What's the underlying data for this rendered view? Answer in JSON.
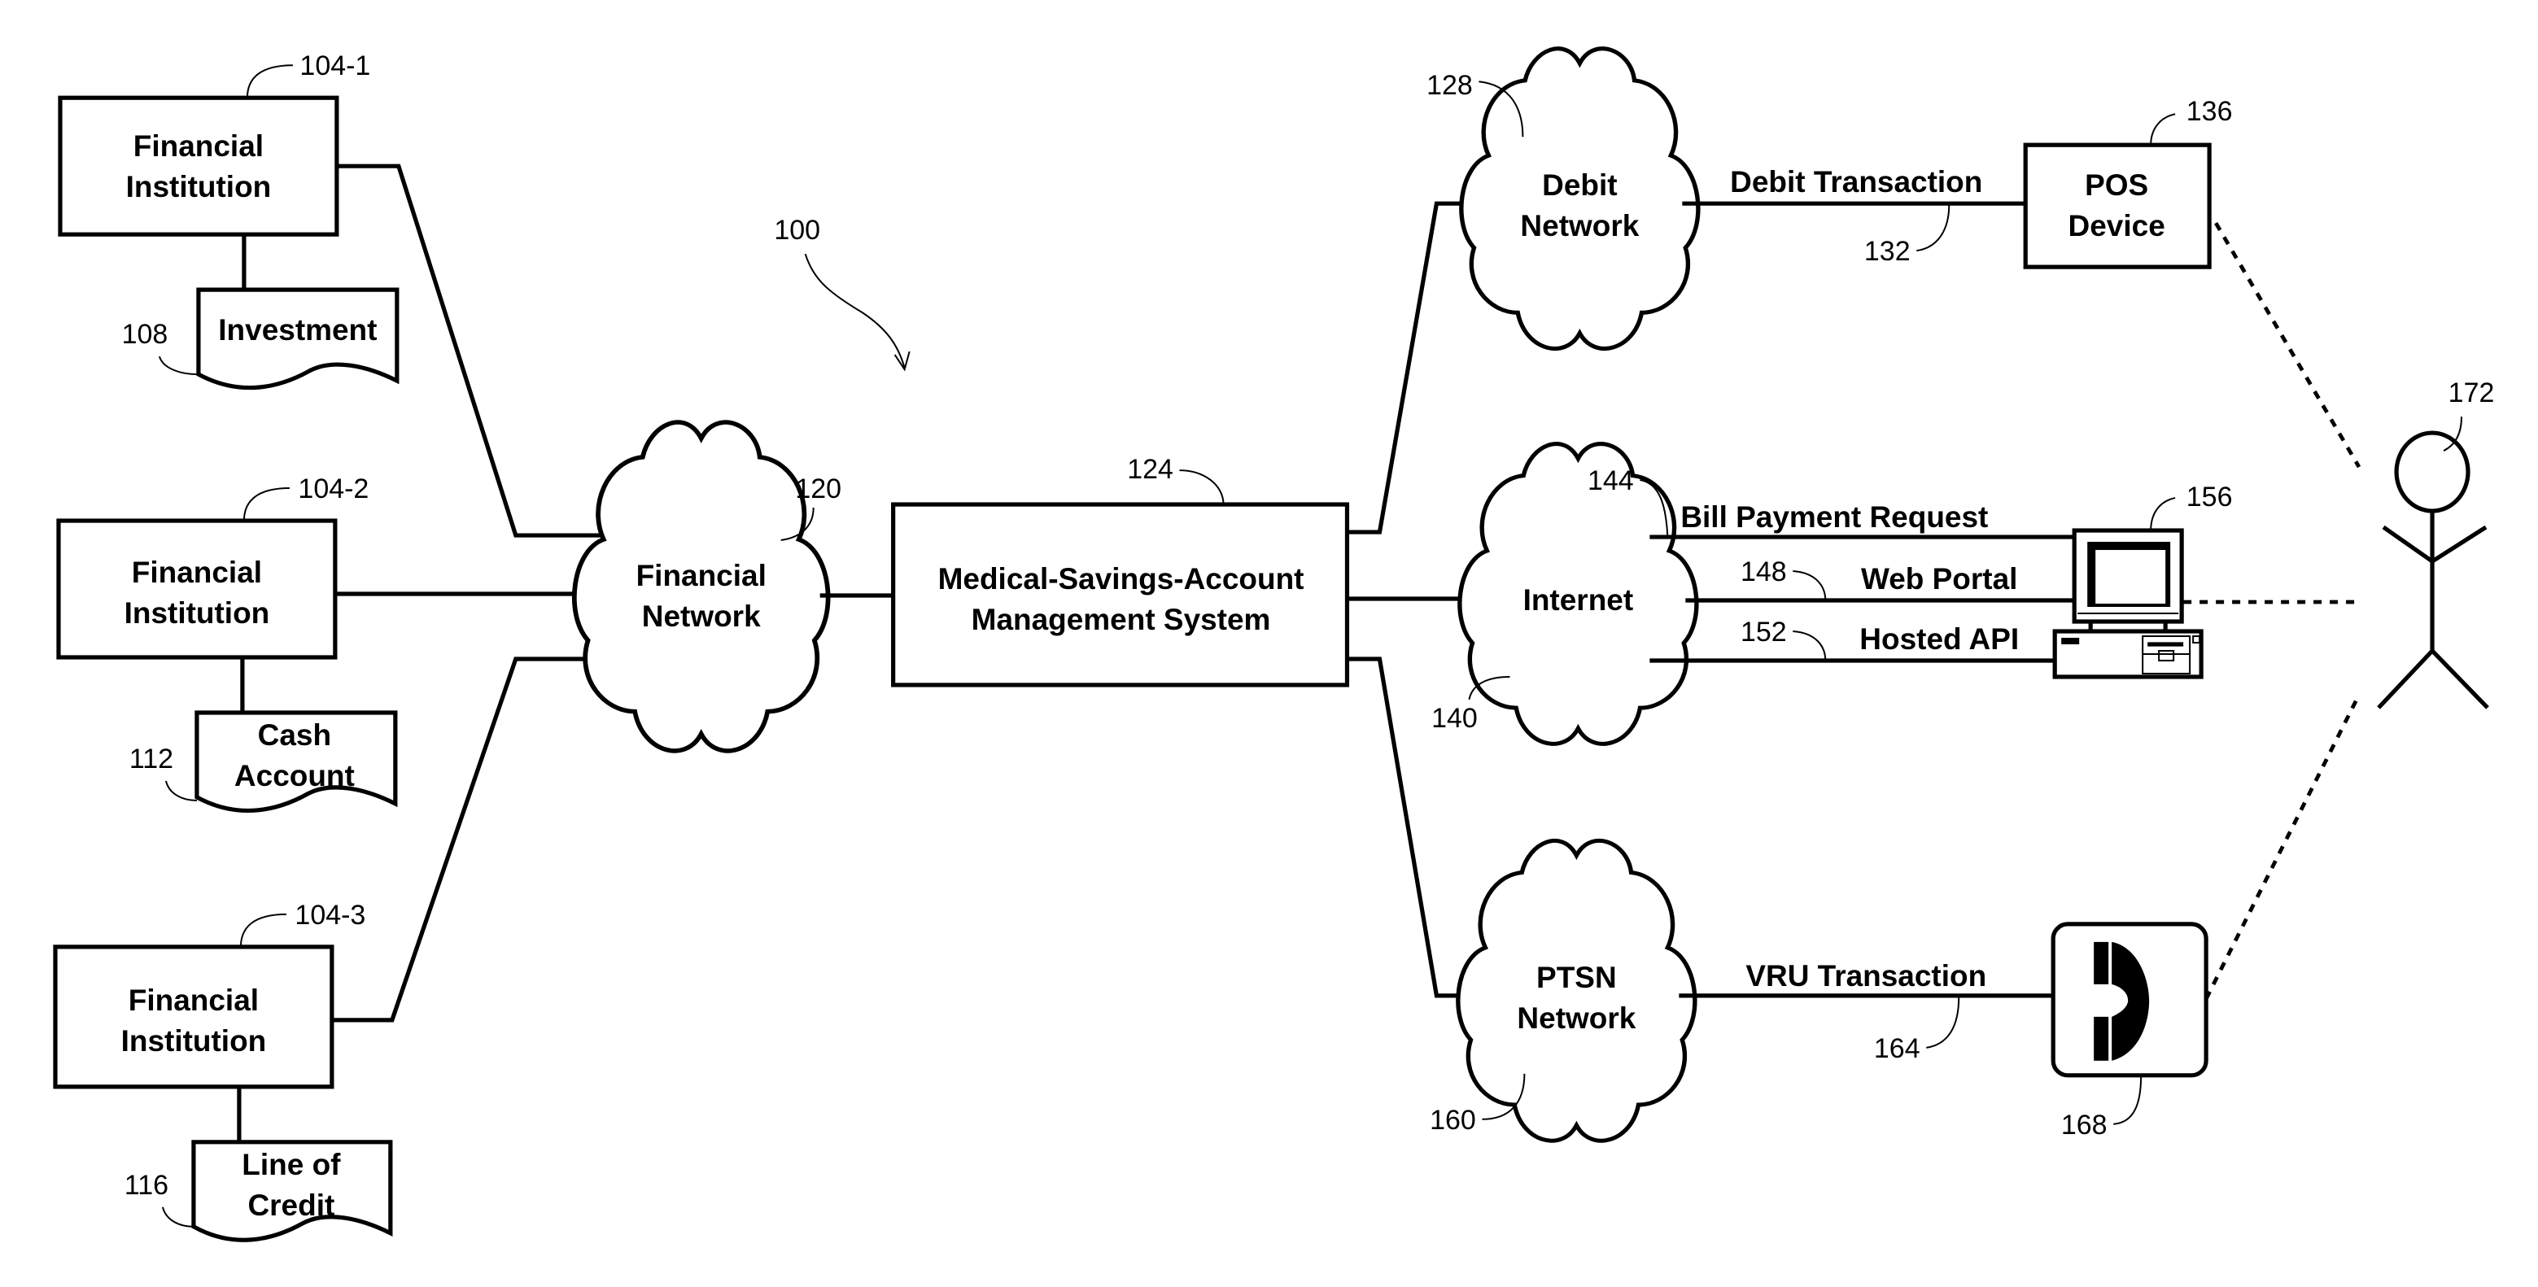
{
  "figure": {
    "reference": "100",
    "financial_institutions": [
      {
        "ref": "104-1",
        "line1": "Financial",
        "line2": "Institution",
        "account": {
          "ref": "108",
          "line1": "Investment",
          "line2": ""
        }
      },
      {
        "ref": "104-2",
        "line1": "Financial",
        "line2": "Institution",
        "account": {
          "ref": "112",
          "line1": "Cash",
          "line2": "Account"
        }
      },
      {
        "ref": "104-3",
        "line1": "Financial",
        "line2": "Institution",
        "account": {
          "ref": "116",
          "line1": "Line of",
          "line2": "Credit"
        }
      }
    ],
    "financial_network": {
      "ref": "120",
      "line1": "Financial",
      "line2": "Network"
    },
    "msa_system": {
      "ref": "124",
      "line1": "Medical-Savings-Account",
      "line2": "Management System"
    },
    "debit_network": {
      "ref": "128",
      "line1": "Debit",
      "line2": "Network"
    },
    "debit_transaction": {
      "ref": "132",
      "label": "Debit Transaction"
    },
    "pos_device": {
      "ref": "136",
      "line1": "POS",
      "line2": "Device"
    },
    "internet": {
      "ref": "140",
      "label": "Internet"
    },
    "bill_payment_request": {
      "ref": "144",
      "label": "Bill Payment Request"
    },
    "web_portal": {
      "ref": "148",
      "label": "Web Portal"
    },
    "hosted_api": {
      "ref": "152",
      "label": "Hosted API"
    },
    "computer": {
      "ref": "156",
      "icon": "desktop-computer-icon"
    },
    "ptsn_network": {
      "ref": "160",
      "line1": "PTSN",
      "line2": "Network"
    },
    "vru_transaction": {
      "ref": "164",
      "label": "VRU Transaction"
    },
    "telephone": {
      "ref": "168",
      "icon": "telephone-handset-icon"
    },
    "user": {
      "ref": "172",
      "icon": "stick-figure-user-icon"
    }
  }
}
